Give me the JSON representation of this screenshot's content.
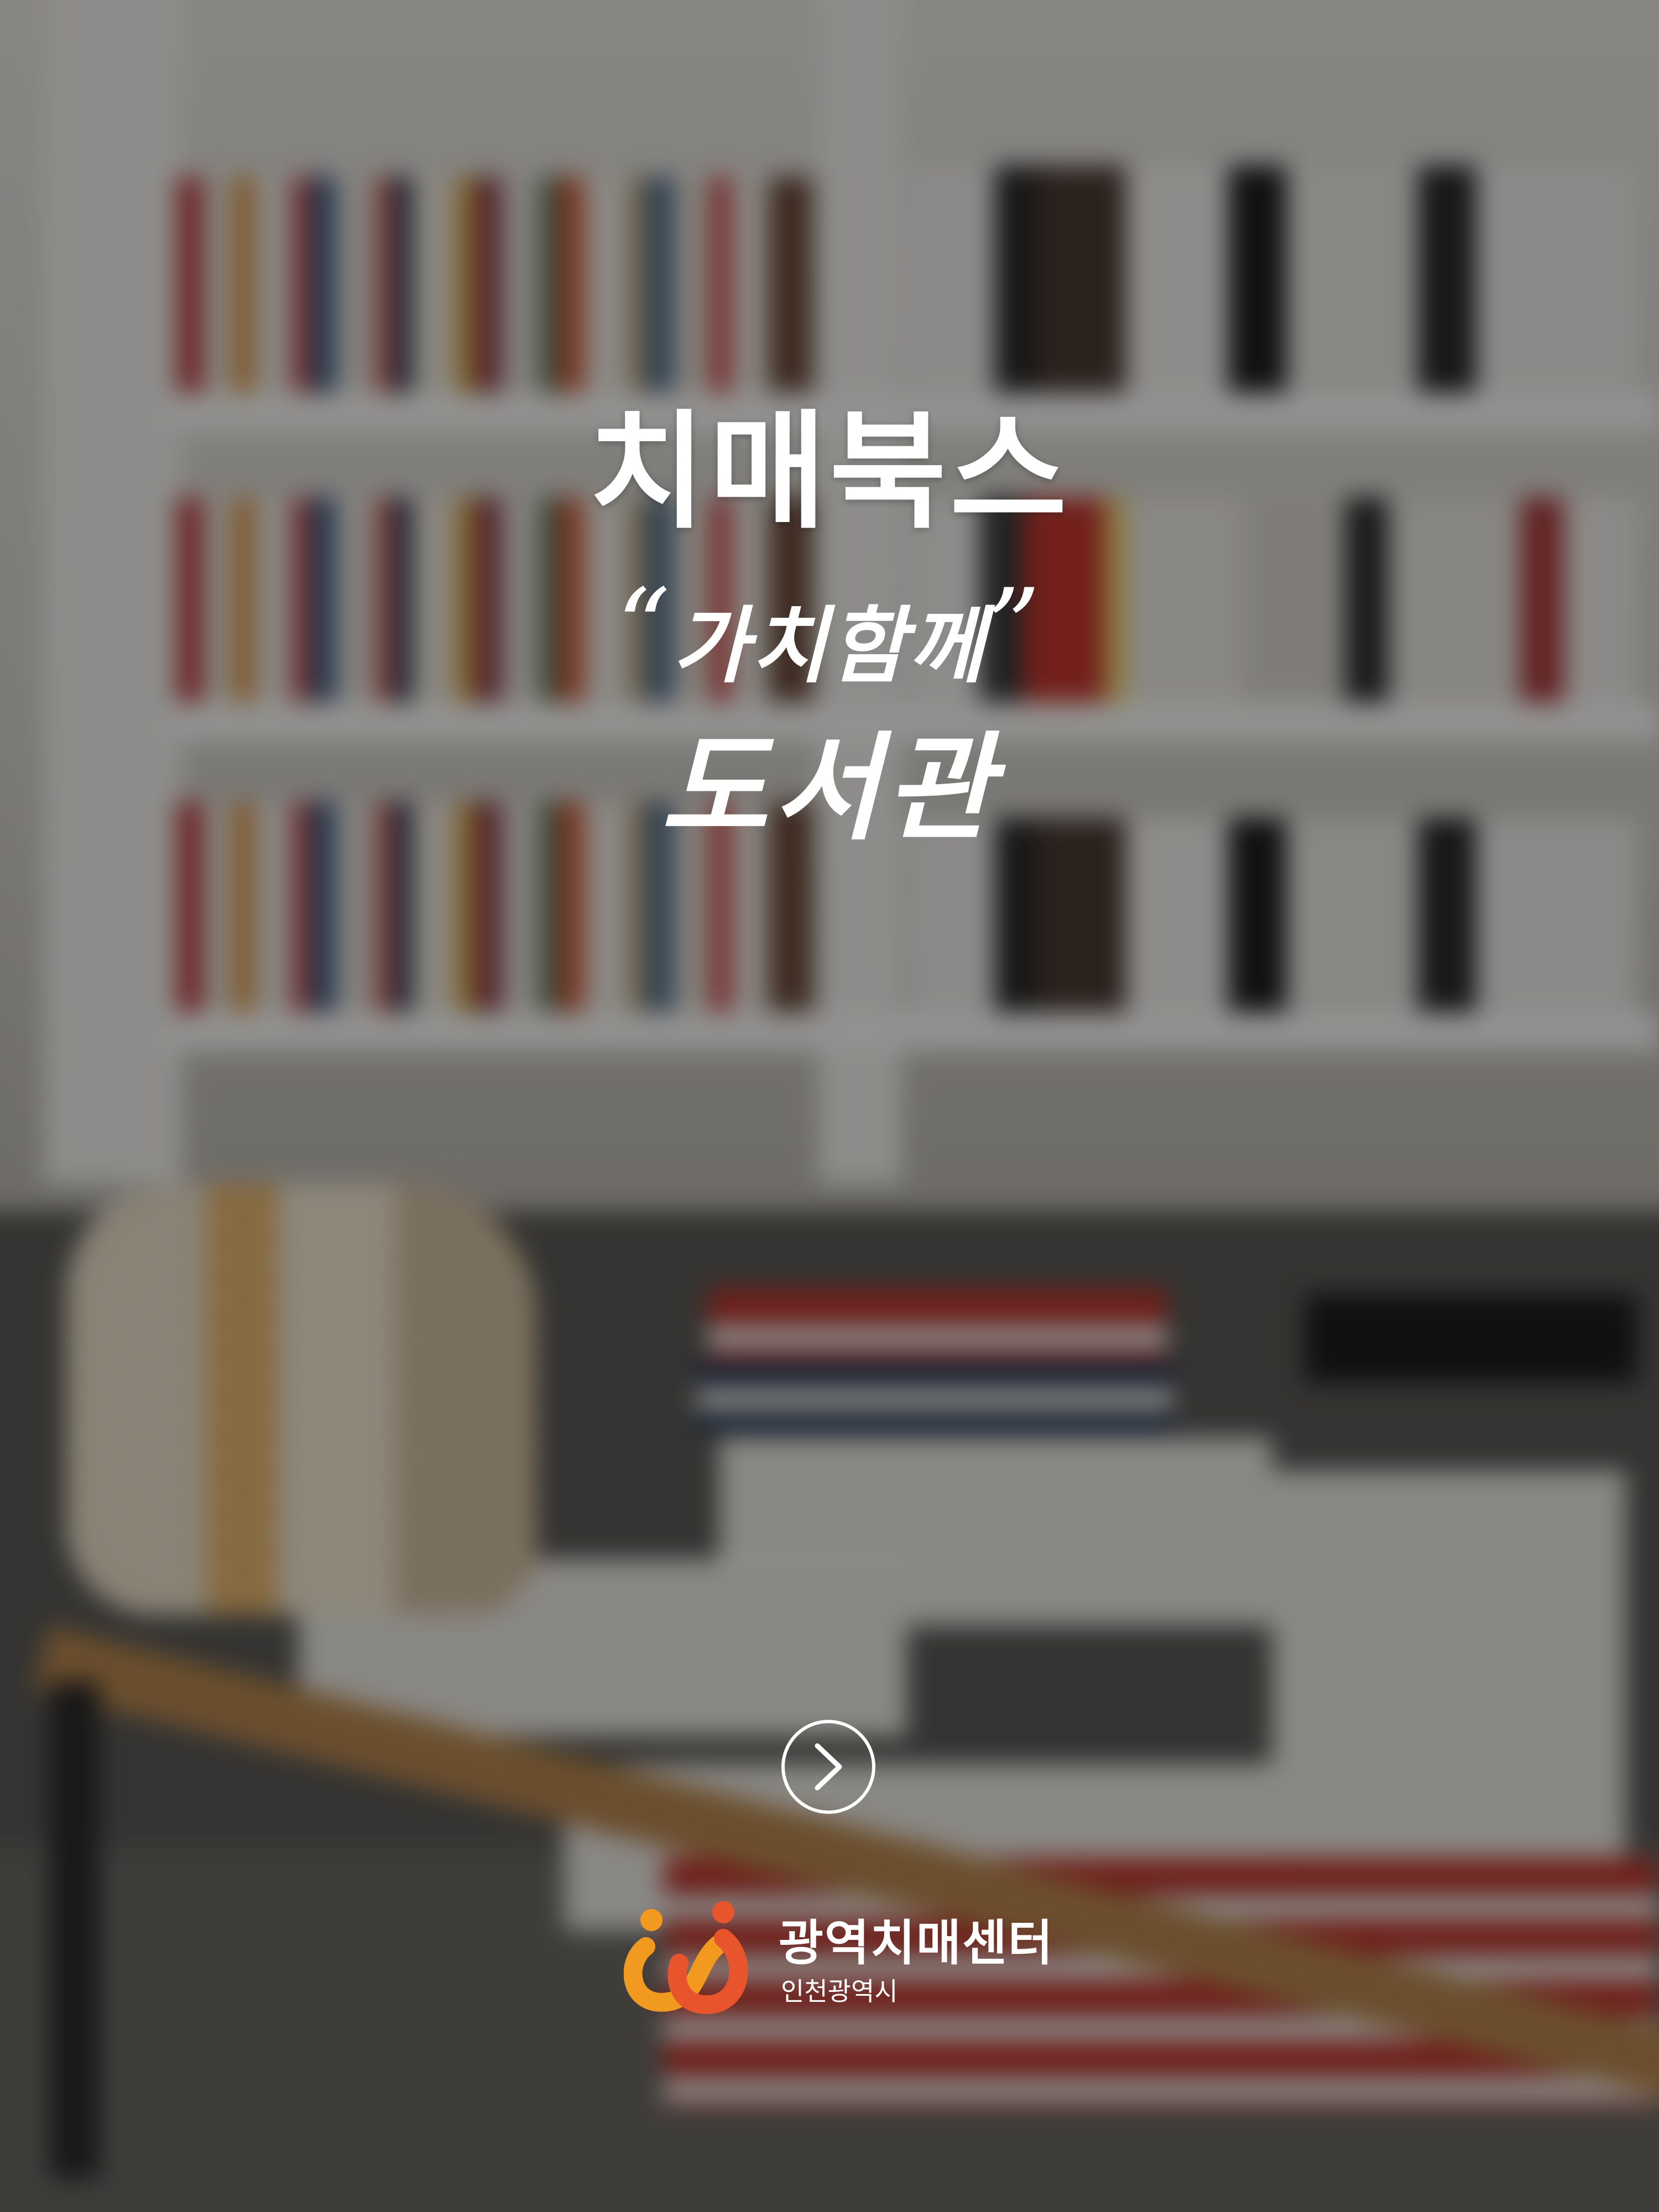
{
  "app": {
    "title": "치매북스",
    "tagline": "가치함께",
    "tagline_open_quote": "“",
    "tagline_close_quote": "”",
    "subtitle": "도서관"
  },
  "navigation": {
    "next_icon": "chevron-right-icon"
  },
  "organization": {
    "name": "광역치매센터",
    "region": "인천광역시",
    "logo_colors": {
      "orange": "#F29A1F",
      "red": "#E8542B"
    }
  },
  "theme": {
    "text_color": "#FFFFFF",
    "overlay": "dark"
  }
}
